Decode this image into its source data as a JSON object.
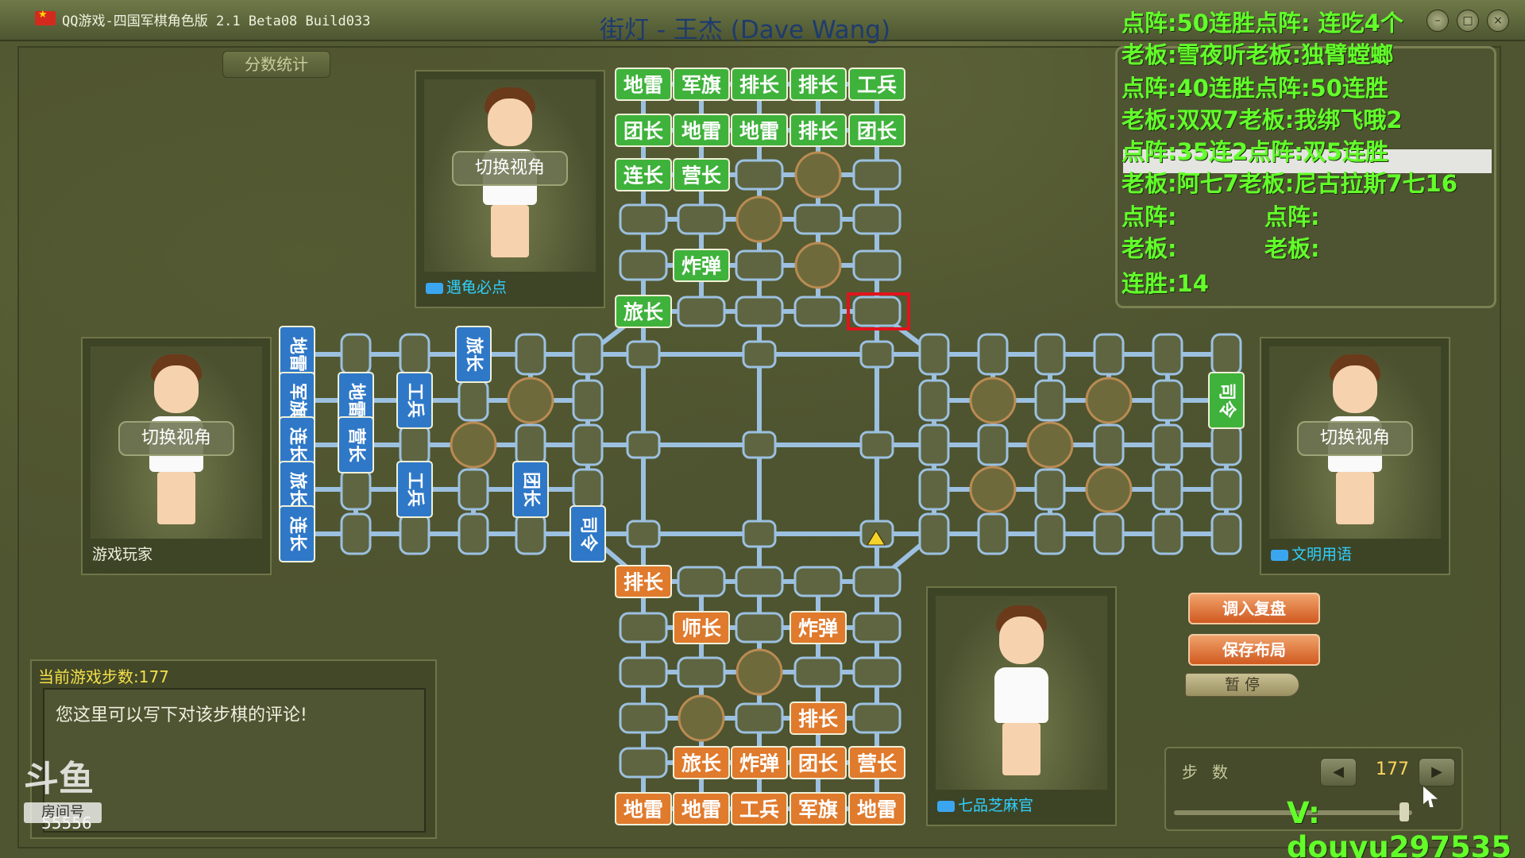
{
  "window": {
    "app_title": "QQ游戏-四国军棋角色版 2.1 Beta08 Build033",
    "game_title": "街灯 - 王杰 (Dave Wang)",
    "score_tab": "分数统计"
  },
  "players": {
    "top": {
      "switch_label": "切换视角",
      "name": "遇龟必点"
    },
    "left": {
      "switch_label": "切换视角",
      "name": "游戏玩家"
    },
    "right": {
      "switch_label": "切换视角",
      "name": "文明用语"
    },
    "bottom": {
      "name": "七品芝麻官"
    }
  },
  "overlay": {
    "lines": [
      "点阵:50连胜点阵:  连吃4个",
      "老板:雪夜听老板:独臂螳螂",
      "点阵:40连胜点阵:50连胜",
      "老板:双双7老板:我绑飞哦2",
      "点阵:35连2点阵:双5连胜",
      "老板:阿七7老板:尼古拉斯7七16",
      "点阵:",
      "老板:",
      "连胜:14"
    ],
    "col2_dot": "点阵:",
    "col2_boss": "老板:"
  },
  "controls": {
    "load_replay": "调入复盘",
    "save_layout": "保存布局",
    "pause": "暂  停",
    "steps_label": "步数",
    "steps_value": "177"
  },
  "comment": {
    "header": "当前游戏步数:177",
    "text": "您这里可以写下对该步棋的评论!"
  },
  "stream": {
    "logo": "斗鱼",
    "room_label": "房间号",
    "room_id": "55556",
    "contact": "V: douyu297535"
  },
  "colors": {
    "top_piece": "#3fb23b",
    "left_piece": "#2f78c8",
    "bottom_piece": "#e07a2c",
    "right_piece": "#3fb23b",
    "rail": "#9cc0e0",
    "overlay_text": "#62ff2a"
  },
  "board": {
    "top_rows": [
      [
        "地雷",
        "军旗",
        "排长",
        "排长",
        "工兵"
      ],
      [
        "团长",
        "地雷",
        "地雷",
        "排长",
        "团长"
      ],
      [
        "连长",
        "营长",
        "",
        "",
        ""
      ],
      [
        "",
        "",
        "",
        "",
        ""
      ],
      [
        "",
        "炸弹",
        "",
        "",
        ""
      ],
      [
        "旅长",
        "",
        "",
        "",
        ""
      ]
    ],
    "bottom_rows": [
      [
        "排长",
        "",
        "",
        "",
        ""
      ],
      [
        "",
        "师长",
        "",
        "炸弹",
        ""
      ],
      [
        "",
        "",
        "",
        "",
        ""
      ],
      [
        "",
        "",
        "",
        "排长",
        ""
      ],
      [
        "",
        "旅长",
        "炸弹",
        "团长",
        "营长"
      ],
      [
        "地雷",
        "地雷",
        "工兵",
        "军旗",
        "地雷"
      ]
    ],
    "left_cols": [
      [
        "地雷",
        "军旗",
        "连长",
        "旅长",
        "连长"
      ],
      [
        "",
        "地雷",
        "营长",
        "",
        ""
      ],
      [
        "",
        "工兵",
        "",
        "工兵",
        ""
      ],
      [
        "旅长",
        "",
        "",
        "",
        ""
      ],
      [
        "",
        "",
        "",
        "团长",
        ""
      ],
      [
        "",
        "",
        "",
        "",
        "司令"
      ]
    ],
    "right_cols": [
      [
        "",
        "",
        "",
        "",
        ""
      ],
      [
        "",
        "",
        "",
        "",
        ""
      ],
      [
        "",
        "",
        "",
        "",
        ""
      ],
      [
        "",
        "",
        "",
        "",
        ""
      ],
      [
        "",
        "",
        "",
        "",
        ""
      ],
      [
        "",
        "司令",
        "",
        "",
        ""
      ]
    ]
  }
}
